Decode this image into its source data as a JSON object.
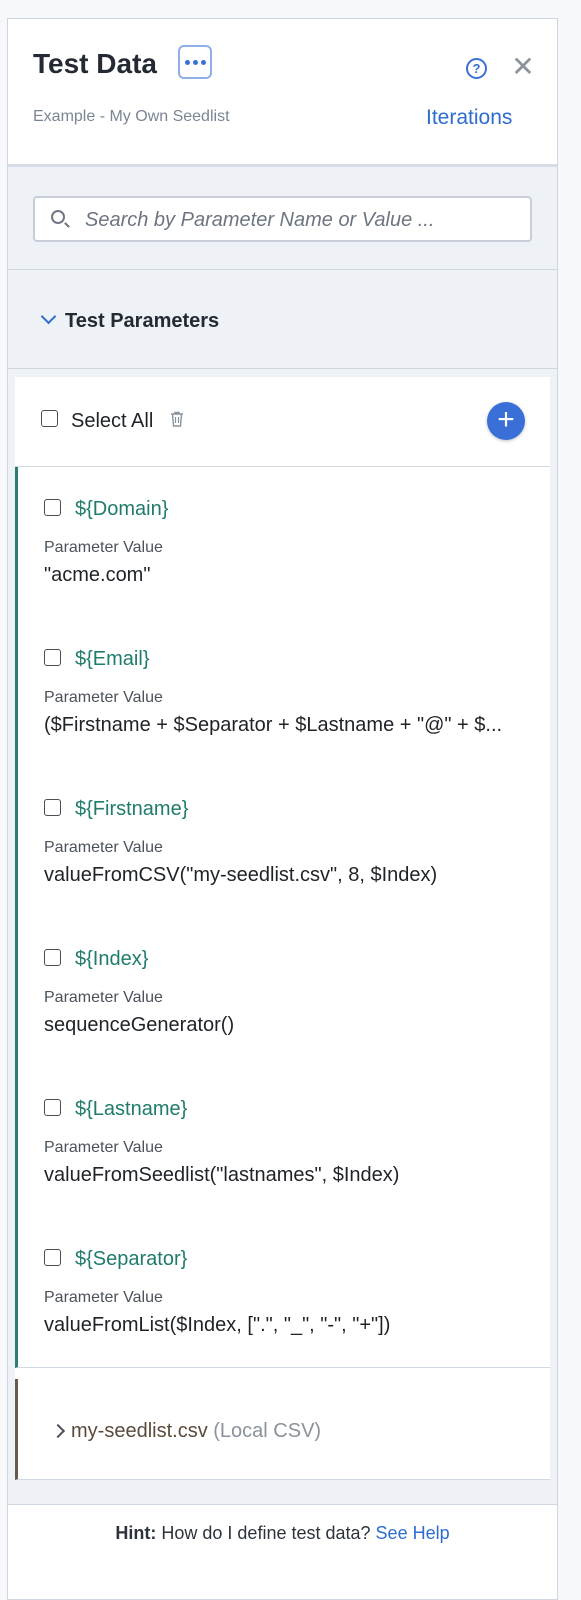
{
  "header": {
    "title": "Test Data",
    "subtitle": "Example - My Own Seedlist",
    "iterations_link": "Iterations",
    "help_icon": "?",
    "close_icon": "✕"
  },
  "search": {
    "placeholder": "Search by Parameter Name or Value ..."
  },
  "section": {
    "title": "Test Parameters"
  },
  "select_all": {
    "label": "Select All",
    "add_icon": "+"
  },
  "parameters": [
    {
      "name": "${Domain}",
      "label": "Parameter Value",
      "value": "\"acme.com\""
    },
    {
      "name": "${Email}",
      "label": "Parameter Value",
      "value": "($Firstname + $Separator + $Lastname + \"@\" + $..."
    },
    {
      "name": "${Firstname}",
      "label": "Parameter Value",
      "value": "valueFromCSV(\"my-seedlist.csv\", 8, $Index)"
    },
    {
      "name": "${Index}",
      "label": "Parameter Value",
      "value": "sequenceGenerator()"
    },
    {
      "name": "${Lastname}",
      "label": "Parameter Value",
      "value": "valueFromSeedlist(\"lastnames\", $Index)"
    },
    {
      "name": "${Separator}",
      "label": "Parameter Value",
      "value": "valueFromList($Index, [\".\", \"_\", \"-\", \"+\"])"
    }
  ],
  "csv_source": {
    "name": "my-seedlist.csv",
    "type": "(Local CSV)"
  },
  "footer": {
    "hint_bold": "Hint:",
    "hint_text": "How do I define test data?",
    "help_link": "See Help"
  },
  "colors": {
    "accent": "#3a6fd8",
    "param_name": "#1f7b6c",
    "param_border": "#2e7b70",
    "csv_border": "#6b5a4b"
  }
}
